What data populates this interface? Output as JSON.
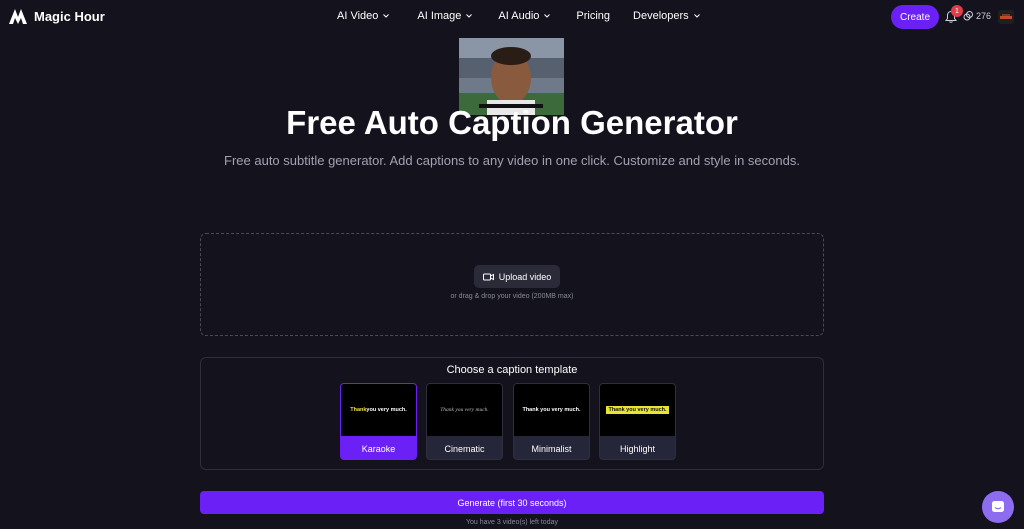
{
  "brand": {
    "name": "Magic Hour"
  },
  "nav": {
    "items": [
      {
        "label": "AI Video",
        "has_menu": true
      },
      {
        "label": "AI Image",
        "has_menu": true
      },
      {
        "label": "AI Audio",
        "has_menu": true
      },
      {
        "label": "Pricing",
        "has_menu": false
      },
      {
        "label": "Developers",
        "has_menu": true
      }
    ]
  },
  "header": {
    "create_label": "Create",
    "notification_count": "1",
    "credits": "276"
  },
  "hero": {
    "title": "Free Auto Caption Generator",
    "subtitle": "Free auto subtitle generator. Add captions to any video in one click. Customize and style in seconds."
  },
  "upload": {
    "button_label": "Upload video",
    "hint": "or drag & drop your video (200MB max)"
  },
  "templates": {
    "title": "Choose a caption template",
    "preview_text": "Thank you very much.",
    "karaoke_highlight": "Thank",
    "karaoke_rest": " you very much.",
    "items": [
      {
        "label": "Karaoke",
        "selected": true
      },
      {
        "label": "Cinematic",
        "selected": false
      },
      {
        "label": "Minimalist",
        "selected": false
      },
      {
        "label": "Highlight",
        "selected": false
      }
    ]
  },
  "generate": {
    "button_label": "Generate (first 30 seconds)",
    "remaining": "You have 3 video(s) left today"
  },
  "colors": {
    "background": "#13121d",
    "accent": "#6b21f5",
    "badge": "#e23b4a",
    "chat": "#8e6cf0"
  },
  "icons": [
    "magic-hour-logo-icon",
    "chevron-down-icon",
    "bell-icon",
    "credits-icon",
    "video-camera-icon",
    "chat-icon"
  ]
}
